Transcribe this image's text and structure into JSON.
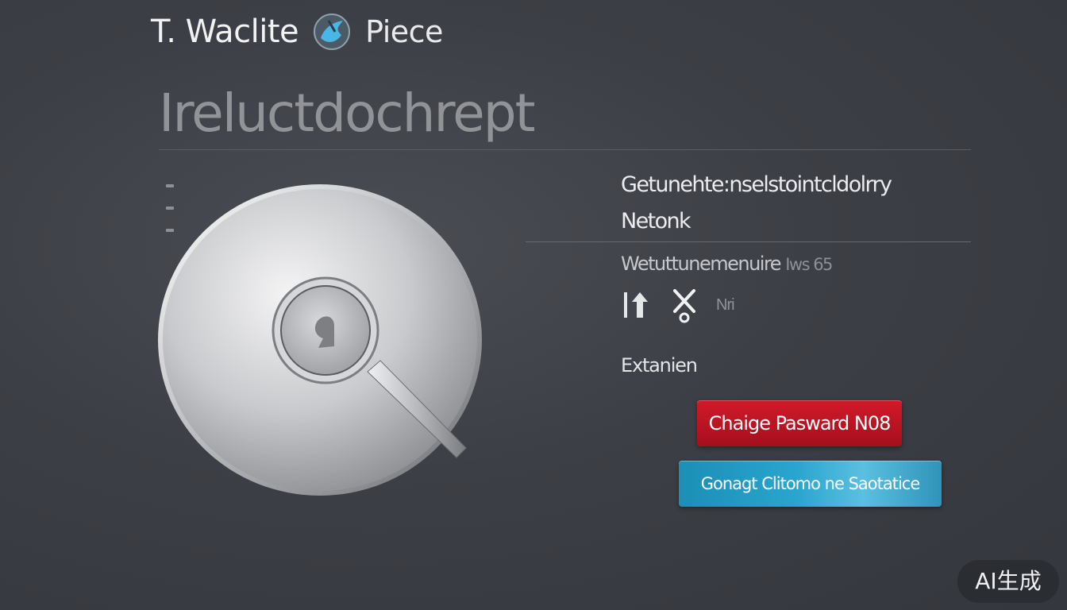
{
  "brand": {
    "name": "T. Waclite",
    "product": "Piece"
  },
  "hero": {
    "headline": "Ireluctdochrept"
  },
  "panel": {
    "description_line1": "Getunehte:nselstointcldolrry",
    "description_line2": "Netonk",
    "subtitle_main": "Wetuttunemenuire",
    "subtitle_faint": "Iws 65",
    "icons": [
      {
        "name": "up-arrow-icon"
      },
      {
        "name": "close-icon"
      }
    ],
    "icon_label": "Nri",
    "extension_label": "Extanien"
  },
  "buttons": {
    "change_password": "Chaige Pasward N08",
    "contact": "Gonagt Clitomo ne Saotatice"
  },
  "watermark": "AI生成",
  "colors": {
    "background": "#3c3f45",
    "primary_red": "#c8131f",
    "accent_blue": "#2aa5cf"
  }
}
